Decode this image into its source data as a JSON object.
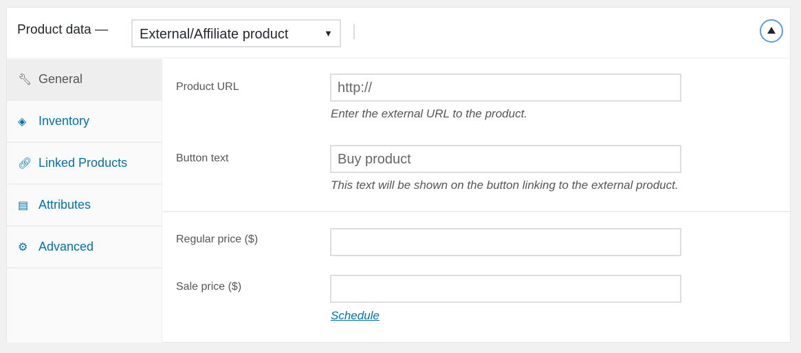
{
  "header": {
    "title": "Product data —",
    "product_type": "External/Affiliate product"
  },
  "sidebar": {
    "items": [
      {
        "label": "General",
        "icon": "wrench-icon",
        "active": true
      },
      {
        "label": "Inventory",
        "icon": "tag-icon"
      },
      {
        "label": "Linked Products",
        "icon": "link-icon"
      },
      {
        "label": "Attributes",
        "icon": "list-icon"
      },
      {
        "label": "Advanced",
        "icon": "gear-icon"
      }
    ]
  },
  "fields": {
    "product_url": {
      "label": "Product URL",
      "placeholder": "http://",
      "description": "Enter the external URL to the product."
    },
    "button_text": {
      "label": "Button text",
      "placeholder": "Buy product",
      "description": "This text will be shown on the button linking to the external product."
    },
    "regular_price": {
      "label": "Regular price ($)",
      "value": ""
    },
    "sale_price": {
      "label": "Sale price ($)",
      "value": ""
    },
    "schedule_link": "Schedule"
  },
  "colors": {
    "link": "#0073aa",
    "toggle": "#5b9dd9"
  }
}
